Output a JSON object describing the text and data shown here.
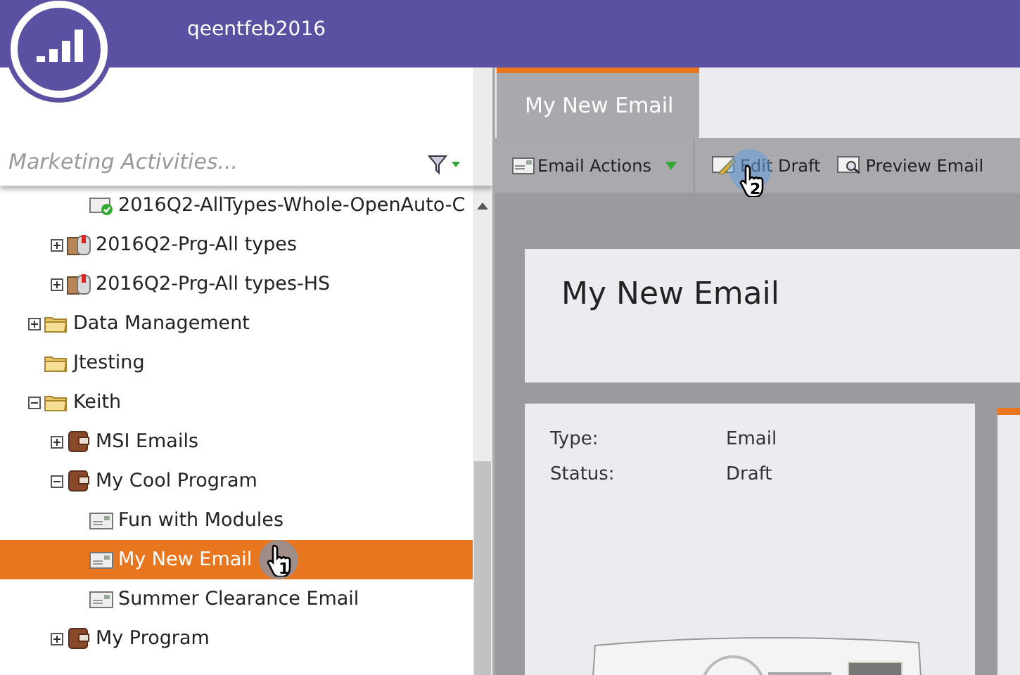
{
  "header": {
    "account": "qeentfeb2016"
  },
  "search": {
    "placeholder": "Marketing Activities..."
  },
  "tree": [
    {
      "children": [
        {
          "children": [
            {
              "label": "2016Q2-AllTypes-Whole-OpenAuto-C",
              "kind": "email-approved",
              "selected": false
            }
          ]
        },
        {
          "label": "2016Q2-Prg-All types",
          "kind": "mail-program",
          "expanded": false,
          "selected": false
        },
        {
          "label": "2016Q2-Prg-All types-HS",
          "kind": "mail-program",
          "expanded": false,
          "selected": false
        }
      ]
    },
    {
      "label": "Data Management",
      "kind": "folder",
      "expanded": false,
      "selected": false
    },
    {
      "label": "Jtesting",
      "kind": "folder",
      "selected": false
    },
    {
      "label": "Keith",
      "kind": "folder",
      "expanded": true,
      "selected": false,
      "children": [
        {
          "label": "MSI Emails",
          "kind": "program",
          "expanded": false,
          "selected": false
        },
        {
          "label": "My Cool Program",
          "kind": "program",
          "expanded": true,
          "selected": false,
          "children": [
            {
              "label": "Fun with Modules",
              "kind": "email",
              "selected": false
            },
            {
              "label": "My New Email",
              "kind": "email",
              "selected": true,
              "callout": "1"
            },
            {
              "label": "Summer Clearance Email",
              "kind": "email",
              "selected": false
            }
          ]
        },
        {
          "label": "My Program",
          "kind": "program",
          "expanded": false,
          "selected": false
        }
      ]
    }
  ],
  "tab": {
    "label": "My New Email",
    "selected": true
  },
  "toolbar": [
    {
      "label": "Email Actions",
      "kind": "menu"
    },
    {
      "label": "Edit Draft",
      "kind": "edit",
      "callout": "2"
    },
    {
      "label": "Preview Email",
      "kind": "preview"
    }
  ],
  "title": "My New Email",
  "details": [
    {
      "label": "Type:",
      "value": "Email"
    },
    {
      "label": "Status:",
      "value": "Draft"
    }
  ]
}
